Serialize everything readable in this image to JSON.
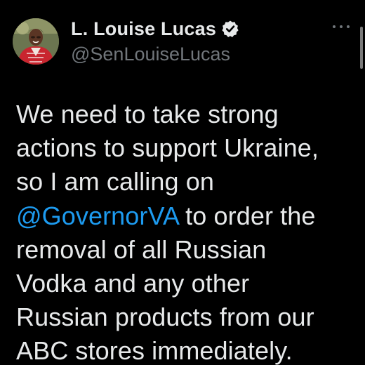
{
  "author": {
    "display_name": "L. Louise Lucas",
    "handle": "@SenLouiseLucas",
    "verified_icon": "verified-badge-icon",
    "avatar_icon": "avatar"
  },
  "menu": {
    "icon": "more-options-icon"
  },
  "tweet": {
    "lines": [
      {
        "text": "We need to take strong"
      },
      {
        "text": "actions to support Ukraine,"
      },
      {
        "text": "so I am calling on"
      },
      {
        "mention": "@GovernorVA",
        "text": " to order the"
      },
      {
        "text": "removal of all Russian"
      },
      {
        "text": "Vodka and any other"
      },
      {
        "text": "Russian products from our"
      },
      {
        "text": "ABC stores immediately."
      }
    ]
  },
  "colors": {
    "background": "#000000",
    "primary_text": "#e7e9ea",
    "secondary_text": "#71767b",
    "link": "#1d9bf0",
    "verified": "#e7e9ea"
  }
}
